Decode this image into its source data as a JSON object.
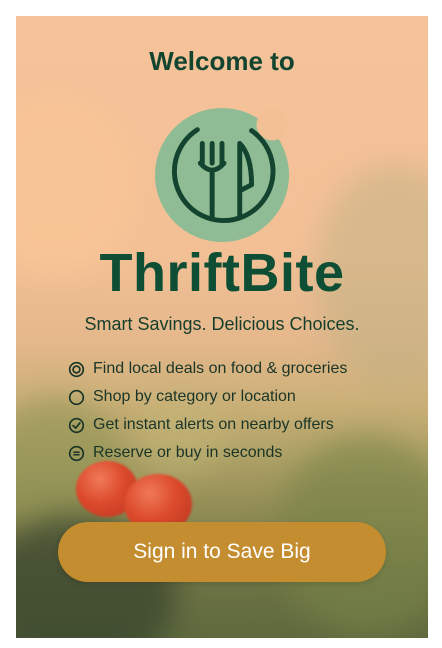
{
  "welcome": {
    "heading": "Welcome to",
    "app_name": "ThriftBite",
    "tagline": "Smart Savings. Delicious Choices."
  },
  "features": [
    {
      "icon": "target-icon",
      "text": "Find local deals on food & groceries"
    },
    {
      "icon": "circle-icon",
      "text": "Shop by category or location"
    },
    {
      "icon": "check-circle-icon",
      "text": "Get instant alerts on nearby offers"
    },
    {
      "icon": "list-circle-icon",
      "text": "Reserve or buy in seconds"
    }
  ],
  "cta": {
    "label": "Sign in to Save Big"
  },
  "colors": {
    "brand_green": "#0d4e34",
    "logo_circle": "#8fbc94",
    "button": "#c48d2f",
    "button_text": "#ffffff"
  }
}
